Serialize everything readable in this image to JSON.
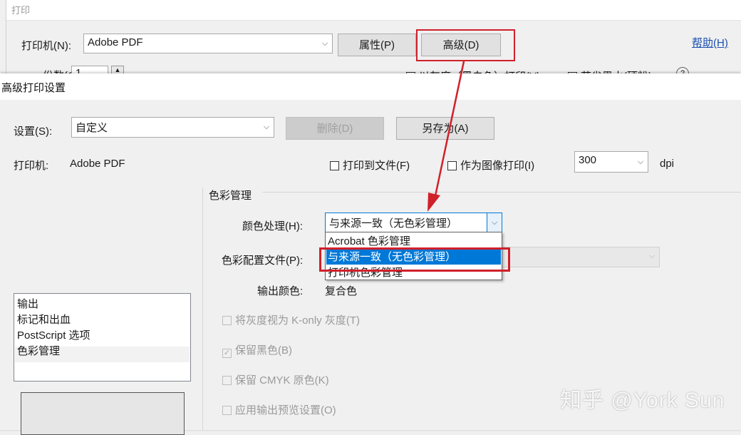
{
  "print_dialog": {
    "title": "打印",
    "printer_label": "打印机(N):",
    "printer_value": "Adobe PDF",
    "properties_button": "属性(P)",
    "advanced_button": "高级(D)",
    "help_link": "帮助(H)",
    "copies_label": "份数(C):",
    "copies_value": "1",
    "checkbox_print_color": "以灰度（黑白色）打印(Y)",
    "checkbox_save_ink": "节省墨水(硬粉)"
  },
  "advanced_dialog": {
    "title": "高级打印设置",
    "settings_label": "设置(S):",
    "settings_value": "自定义",
    "delete_button": "删除(D)",
    "save_as_button": "另存为(A)",
    "printer_label": "打印机:",
    "printer_value": "Adobe PDF",
    "print_to_file": "打印到文件(F)",
    "print_as_image": "作为图像打印(I)",
    "dpi_value": "300",
    "dpi_unit": "dpi",
    "nav_items": [
      "输出",
      "标记和出血",
      "PostScript 选项",
      "色彩管理"
    ],
    "color_mgmt": {
      "group_title": "色彩管理",
      "color_handling_label": "颜色处理(H):",
      "color_handling_value": "与来源一致（无色彩管理）",
      "color_profile_label": "色彩配置文件(P):",
      "output_color_label": "输出颜色:",
      "output_color_value": "复合色",
      "options": [
        {
          "label": "将灰度视为 K-only 灰度(T)",
          "checked": false,
          "enabled": false
        },
        {
          "label": "保留黑色(B)",
          "checked": true,
          "enabled": false
        },
        {
          "label": "保留 CMYK 原色(K)",
          "checked": false,
          "enabled": false
        },
        {
          "label": "应用输出预览设置(O)",
          "checked": false,
          "enabled": false
        }
      ],
      "dropdown_options": [
        "Acrobat 色彩管理",
        "与来源一致（无色彩管理）",
        "打印机色彩管理"
      ],
      "dropdown_selected_index": 1
    }
  },
  "watermark": "知乎 @York Sun",
  "colors": {
    "highlight": "#d0202a",
    "selection": "#0078d7",
    "link": "#1a4fb0"
  },
  "icons": {
    "dropdown_arrow": "chevron-down-icon",
    "help": "help-circle-icon",
    "check": "check-icon"
  }
}
